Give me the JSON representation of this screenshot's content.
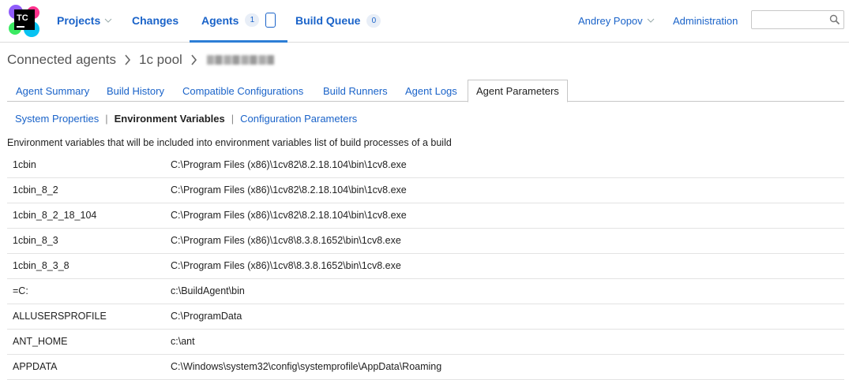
{
  "header": {
    "logo_text": "TC",
    "nav": [
      {
        "label": "Projects",
        "has_caret": true
      },
      {
        "label": "Changes"
      },
      {
        "label": "Agents",
        "badge": "1",
        "active": true
      },
      {
        "label": "Build Queue",
        "badge": "0"
      }
    ],
    "user": "Andrey Popov",
    "administration": "Administration",
    "search_placeholder": ""
  },
  "breadcrumb": [
    "Connected agents",
    "1c pool"
  ],
  "tabs": [
    "Agent Summary",
    "Build History",
    "Compatible Configurations",
    "Build Runners",
    "Agent Logs",
    "Agent Parameters"
  ],
  "subtabs": [
    "System Properties",
    "Environment Variables",
    "Configuration Parameters"
  ],
  "description": "Environment variables that will be included into environment variables list of build processes of a build",
  "env_vars": [
    {
      "name": "1cbin",
      "value": "C:\\Program Files (x86)\\1cv82\\8.2.18.104\\bin\\1cv8.exe"
    },
    {
      "name": "1cbin_8_2",
      "value": "C:\\Program Files (x86)\\1cv82\\8.2.18.104\\bin\\1cv8.exe"
    },
    {
      "name": "1cbin_8_2_18_104",
      "value": "C:\\Program Files (x86)\\1cv82\\8.2.18.104\\bin\\1cv8.exe"
    },
    {
      "name": "1cbin_8_3",
      "value": "C:\\Program Files (x86)\\1cv8\\8.3.8.1652\\bin\\1cv8.exe"
    },
    {
      "name": "1cbin_8_3_8",
      "value": "C:\\Program Files (x86)\\1cv8\\8.3.8.1652\\bin\\1cv8.exe"
    },
    {
      "name": "=C:",
      "value": "c:\\BuildAgent\\bin"
    },
    {
      "name": "ALLUSERSPROFILE",
      "value": "C:\\ProgramData"
    },
    {
      "name": "ANT_HOME",
      "value": "c:\\ant"
    },
    {
      "name": "APPDATA",
      "value": "C:\\Windows\\system32\\config\\systemprofile\\AppData\\Roaming"
    }
  ],
  "colors": {
    "link": "#1a63c9",
    "active_underline": "#2d7ed6",
    "logo_bg": "#000000"
  }
}
